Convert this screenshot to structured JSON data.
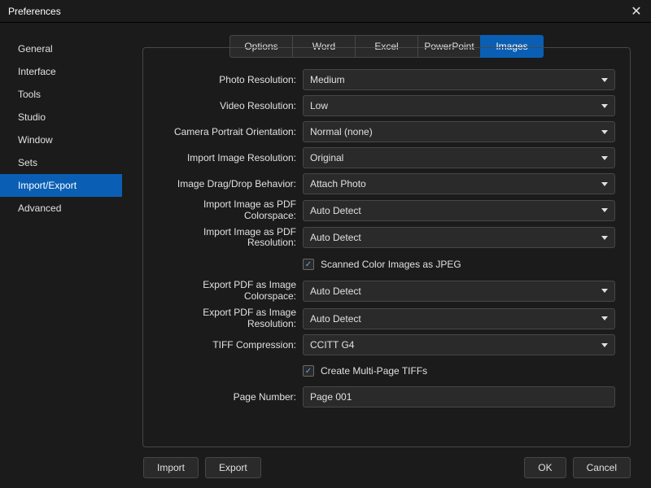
{
  "window": {
    "title": "Preferences"
  },
  "sidebar": {
    "items": [
      {
        "label": "General"
      },
      {
        "label": "Interface"
      },
      {
        "label": "Tools"
      },
      {
        "label": "Studio"
      },
      {
        "label": "Window"
      },
      {
        "label": "Sets"
      },
      {
        "label": "Import/Export"
      },
      {
        "label": "Advanced"
      }
    ],
    "active_index": 6
  },
  "tabs": {
    "items": [
      {
        "label": "Options"
      },
      {
        "label": "Word"
      },
      {
        "label": "Excel"
      },
      {
        "label": "PowerPoint"
      },
      {
        "label": "Images"
      }
    ],
    "active_index": 4
  },
  "fields": {
    "photo_resolution": {
      "label": "Photo Resolution:",
      "value": "Medium"
    },
    "video_resolution": {
      "label": "Video Resolution:",
      "value": "Low"
    },
    "camera_portrait_orientation": {
      "label": "Camera Portrait Orientation:",
      "value": "Normal (none)"
    },
    "import_image_resolution": {
      "label": "Import Image Resolution:",
      "value": "Original"
    },
    "image_drag_drop_behavior": {
      "label": "Image Drag/Drop Behavior:",
      "value": "Attach Photo"
    },
    "import_image_pdf_colorspace": {
      "label": "Import Image as PDF Colorspace:",
      "value": "Auto Detect"
    },
    "import_image_pdf_resolution": {
      "label": "Import Image as PDF Resolution:",
      "value": "Auto Detect"
    },
    "scanned_color_images_jpeg": {
      "label": "Scanned Color Images as JPEG",
      "checked": true
    },
    "export_pdf_image_colorspace": {
      "label": "Export PDF as Image Colorspace:",
      "value": "Auto Detect"
    },
    "export_pdf_image_resolution": {
      "label": "Export PDF as Image Resolution:",
      "value": "Auto Detect"
    },
    "tiff_compression": {
      "label": "TIFF Compression:",
      "value": "CCITT G4"
    },
    "create_multipage_tiffs": {
      "label": "Create Multi-Page TIFFs",
      "checked": true
    },
    "page_number": {
      "label": "Page Number:",
      "value": "Page 001"
    }
  },
  "footer": {
    "import": "Import",
    "export": "Export",
    "ok": "OK",
    "cancel": "Cancel"
  }
}
